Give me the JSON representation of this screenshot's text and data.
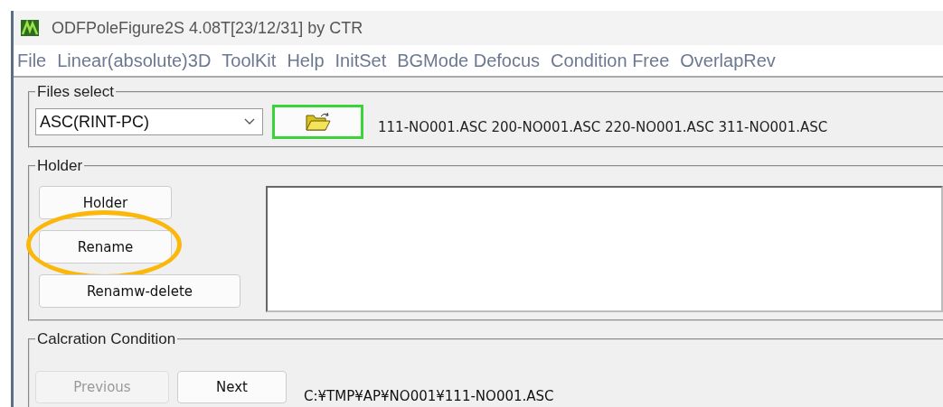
{
  "window": {
    "title": "ODFPoleFigure2S 4.08T[23/12/31] by CTR"
  },
  "menu": [
    "File",
    "Linear(absolute)3D",
    "ToolKit",
    "Help",
    "InitSet",
    "BGMode Defocus",
    "Condition Free",
    "OverlapRev"
  ],
  "files_select": {
    "label": "Files select",
    "format": "ASC(RINT-PC)",
    "files": "111-NO001.ASC 200-NO001.ASC 220-NO001.ASC 311-NO001.ASC"
  },
  "holder": {
    "label": "Holder",
    "buttons": [
      {
        "label": "Holder",
        "highlighted": false
      },
      {
        "label": "Rename",
        "highlighted": true
      },
      {
        "label": "Renamw-delete",
        "highlighted": false
      }
    ]
  },
  "calc": {
    "label": "Calcration Condition",
    "buttons": [
      {
        "label": "Previous",
        "disabled": true
      },
      {
        "label": "Next",
        "disabled": false
      }
    ],
    "path": "C:¥TMP¥AP¥NO001¥111-NO001.ASC"
  }
}
